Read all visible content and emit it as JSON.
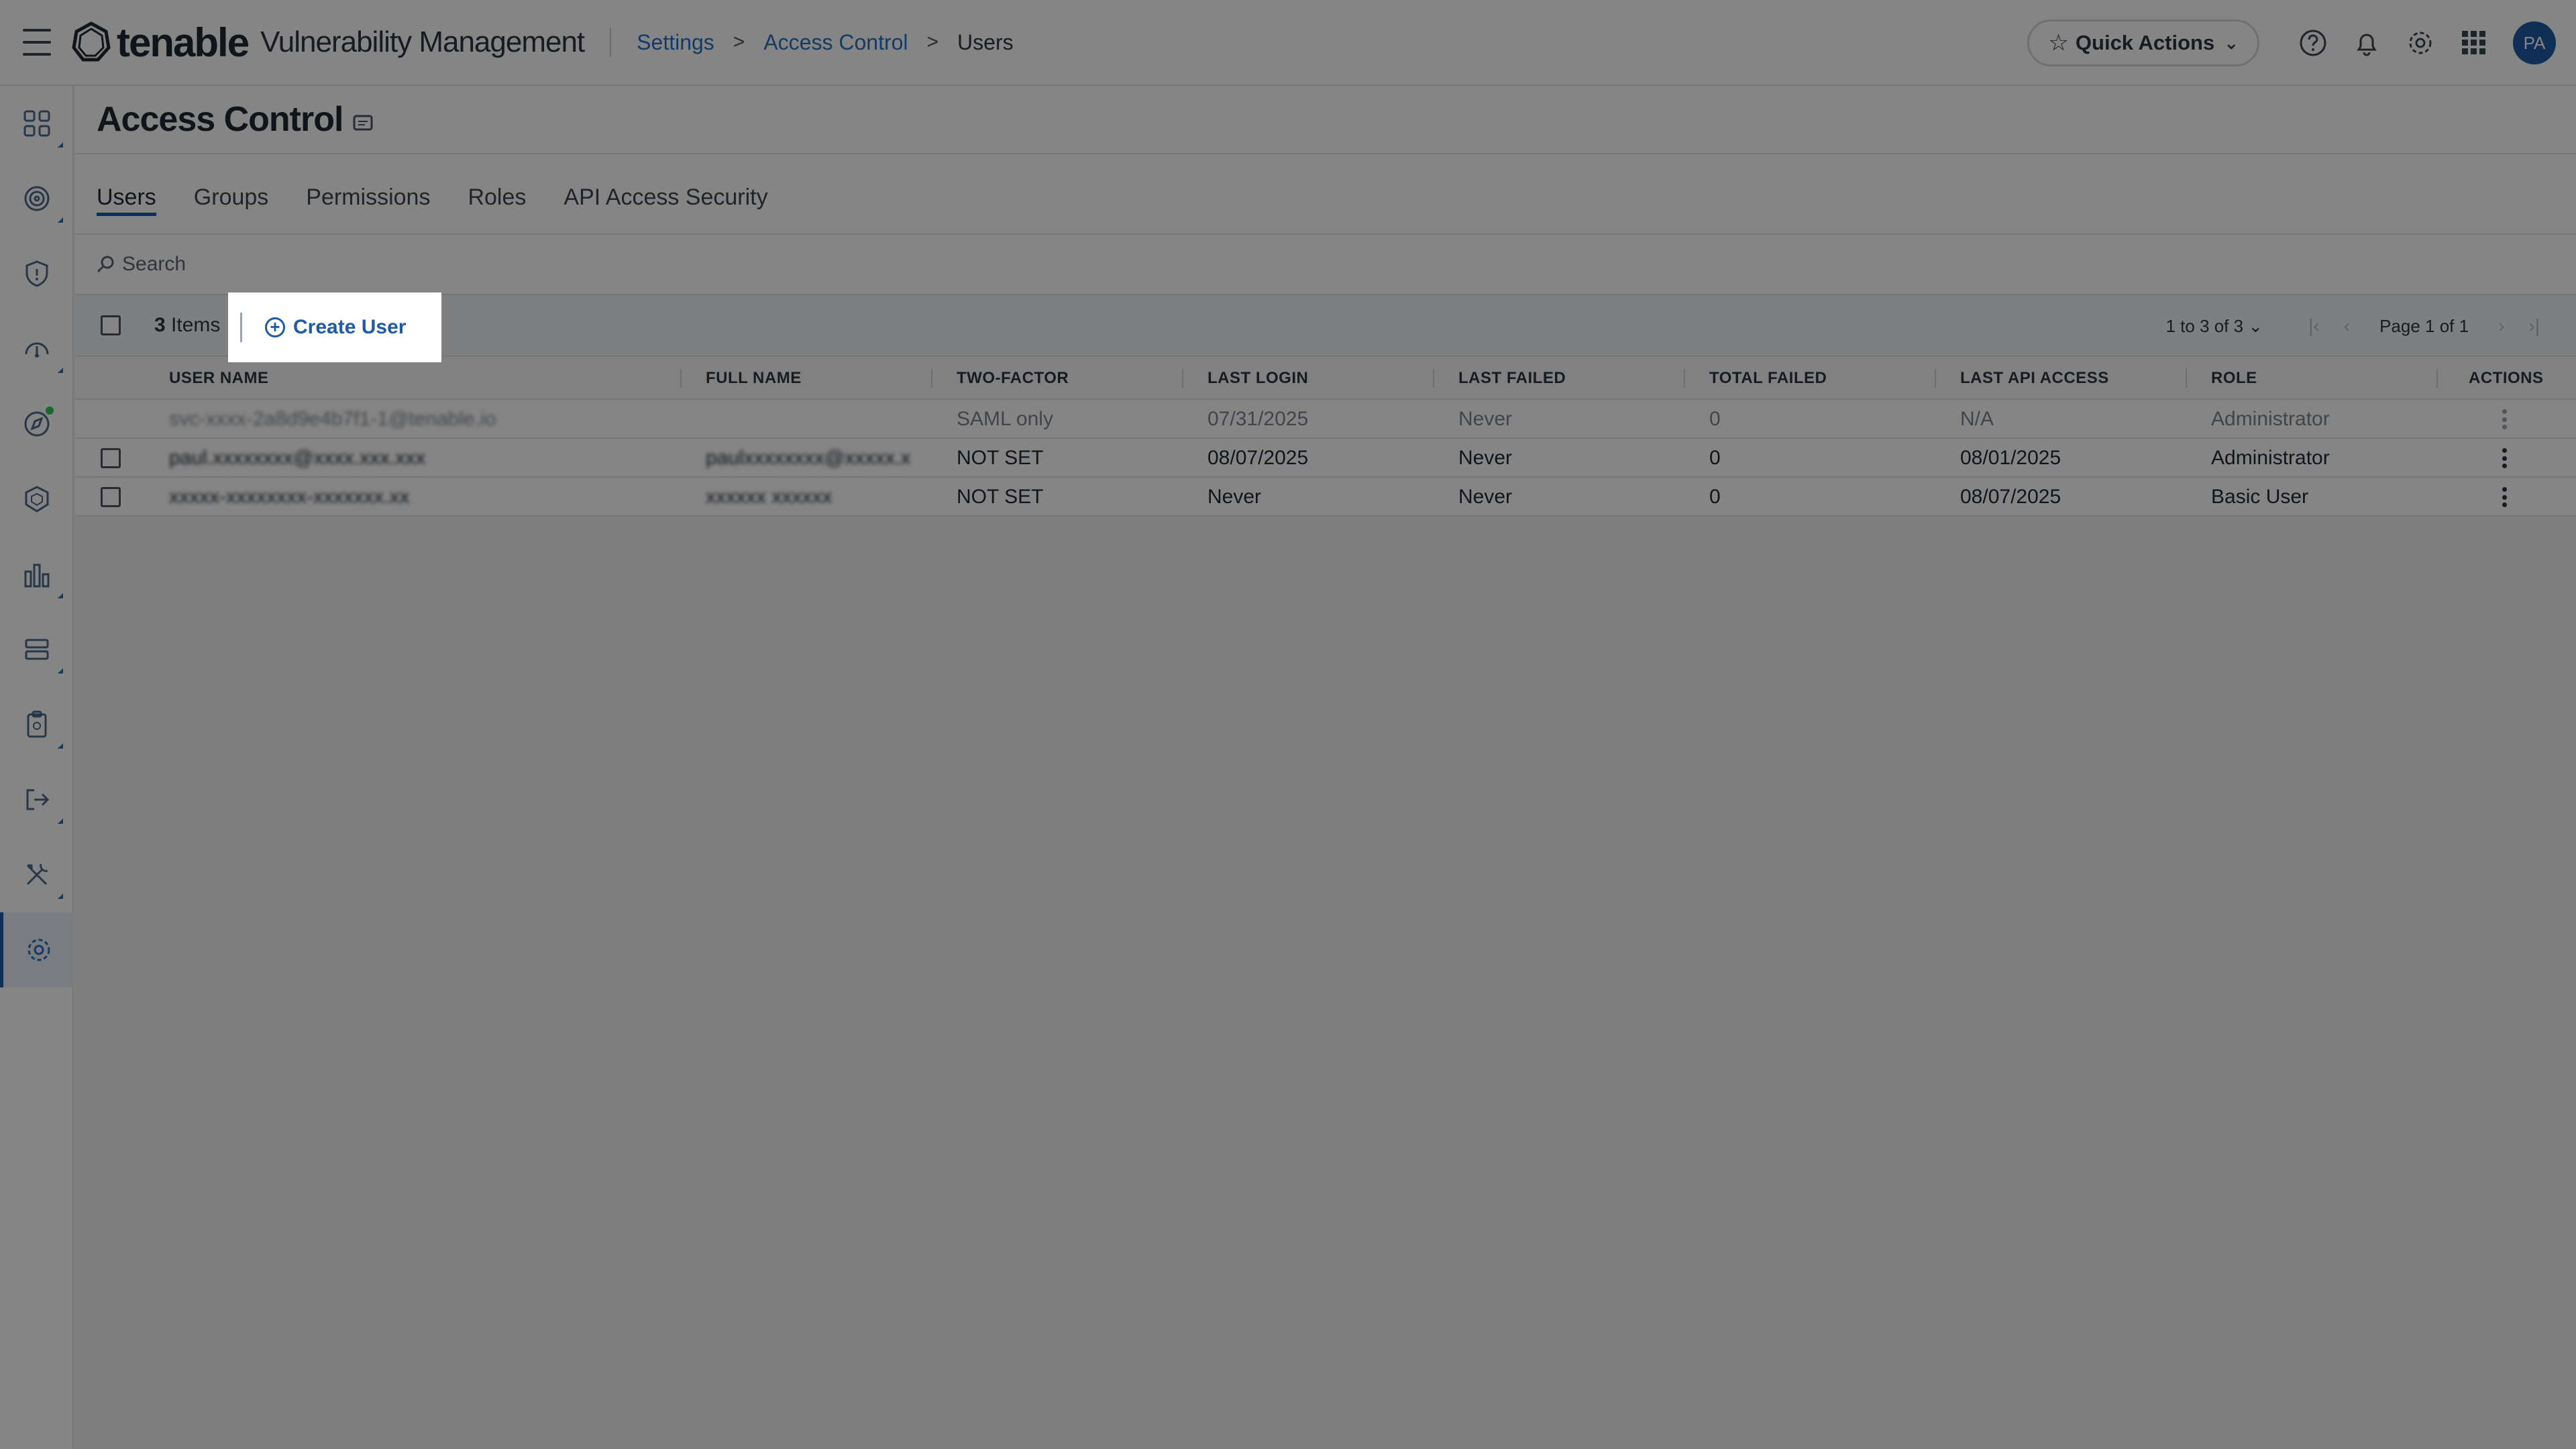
{
  "header": {
    "logo_text": "tenable",
    "product_name": "Vulnerability Management",
    "breadcrumb": [
      {
        "label": "Settings"
      },
      {
        "label": "Access Control"
      },
      {
        "label": "Users"
      }
    ],
    "breadcrumb_separator": ">",
    "quick_actions_label": "Quick Actions",
    "avatar_initials": "PA"
  },
  "sidenav": {
    "items": [
      {
        "icon": "dashboard-grid-icon"
      },
      {
        "icon": "target-icon"
      },
      {
        "icon": "shield-icon"
      },
      {
        "icon": "gauge-icon"
      },
      {
        "icon": "compass-icon"
      },
      {
        "icon": "cube-shield-icon"
      },
      {
        "icon": "bar-chart-icon"
      },
      {
        "icon": "server-stack-icon"
      },
      {
        "icon": "clipboard-icon"
      },
      {
        "icon": "export-arrow-icon"
      },
      {
        "icon": "tools-icon"
      },
      {
        "icon": "settings-gear-icon"
      }
    ],
    "active_index": 11
  },
  "page": {
    "title": "Access Control",
    "tabs": [
      {
        "label": "Users",
        "active": true
      },
      {
        "label": "Groups",
        "active": false
      },
      {
        "label": "Permissions",
        "active": false
      },
      {
        "label": "Roles",
        "active": false
      },
      {
        "label": "API Access Security",
        "active": false
      }
    ],
    "search_placeholder": "Search"
  },
  "toolbar": {
    "items_count": "3",
    "items_label": "Items",
    "create_user_label": "Create User",
    "range_label": "1 to 3 of 3",
    "page_label": "Page 1 of 1"
  },
  "table": {
    "columns": [
      "USER NAME",
      "FULL NAME",
      "TWO-FACTOR",
      "LAST LOGIN",
      "LAST FAILED",
      "TOTAL FAILED",
      "LAST API ACCESS",
      "ROLE",
      "ACTIONS"
    ],
    "rows": [
      {
        "username": "svc-xxxx-2a8d9e4b7f1-1@tenable.io",
        "fullname": "",
        "two_factor": "SAML only",
        "last_login": "07/31/2025",
        "last_failed": "Never",
        "total_failed": "0",
        "last_api_access": "N/A",
        "role": "Administrator",
        "disabled": true
      },
      {
        "username": "paul.xxxxxxxx@xxxx.xxx.xxx",
        "fullname": "paulxxxxxxxx@xxxxx.x",
        "two_factor": "NOT SET",
        "last_login": "08/07/2025",
        "last_failed": "Never",
        "total_failed": "0",
        "last_api_access": "08/01/2025",
        "role": "Administrator",
        "disabled": false
      },
      {
        "username": "xxxxx-xxxxxxxx-xxxxxxx.xx",
        "fullname": "xxxxxx xxxxxx",
        "two_factor": "NOT SET",
        "last_login": "Never",
        "last_failed": "Never",
        "total_failed": "0",
        "last_api_access": "08/07/2025",
        "role": "Basic User",
        "disabled": false
      }
    ]
  },
  "colors": {
    "accent": "#1e5aa8",
    "link": "#2a6fc0",
    "overlay": "rgba(0,0,0,0.48)"
  }
}
